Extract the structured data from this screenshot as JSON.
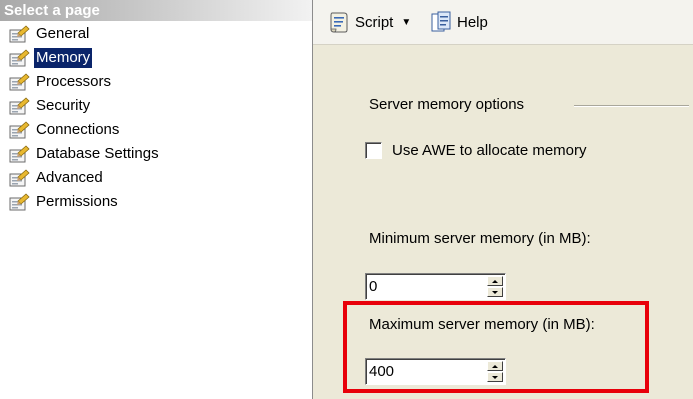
{
  "sidebar": {
    "header": "Select a page",
    "items": [
      {
        "label": "General",
        "selected": false
      },
      {
        "label": "Memory",
        "selected": true
      },
      {
        "label": "Processors",
        "selected": false
      },
      {
        "label": "Security",
        "selected": false
      },
      {
        "label": "Connections",
        "selected": false
      },
      {
        "label": "Database Settings",
        "selected": false
      },
      {
        "label": "Advanced",
        "selected": false
      },
      {
        "label": "Permissions",
        "selected": false
      }
    ],
    "item_icon": "properties-page-icon",
    "selected_color": "#0a246a"
  },
  "toolbar": {
    "script_label": "Script",
    "script_icon": "script-icon",
    "help_label": "Help",
    "help_icon": "help-icon"
  },
  "main": {
    "section_title": "Server memory options",
    "awe_label": "Use AWE to allocate memory",
    "awe_checked": false,
    "min_label": "Minimum server memory (in MB):",
    "min_value": "0",
    "max_label": "Maximum server memory (in MB):",
    "max_value": "400",
    "highlight_color": "#e8000a"
  }
}
